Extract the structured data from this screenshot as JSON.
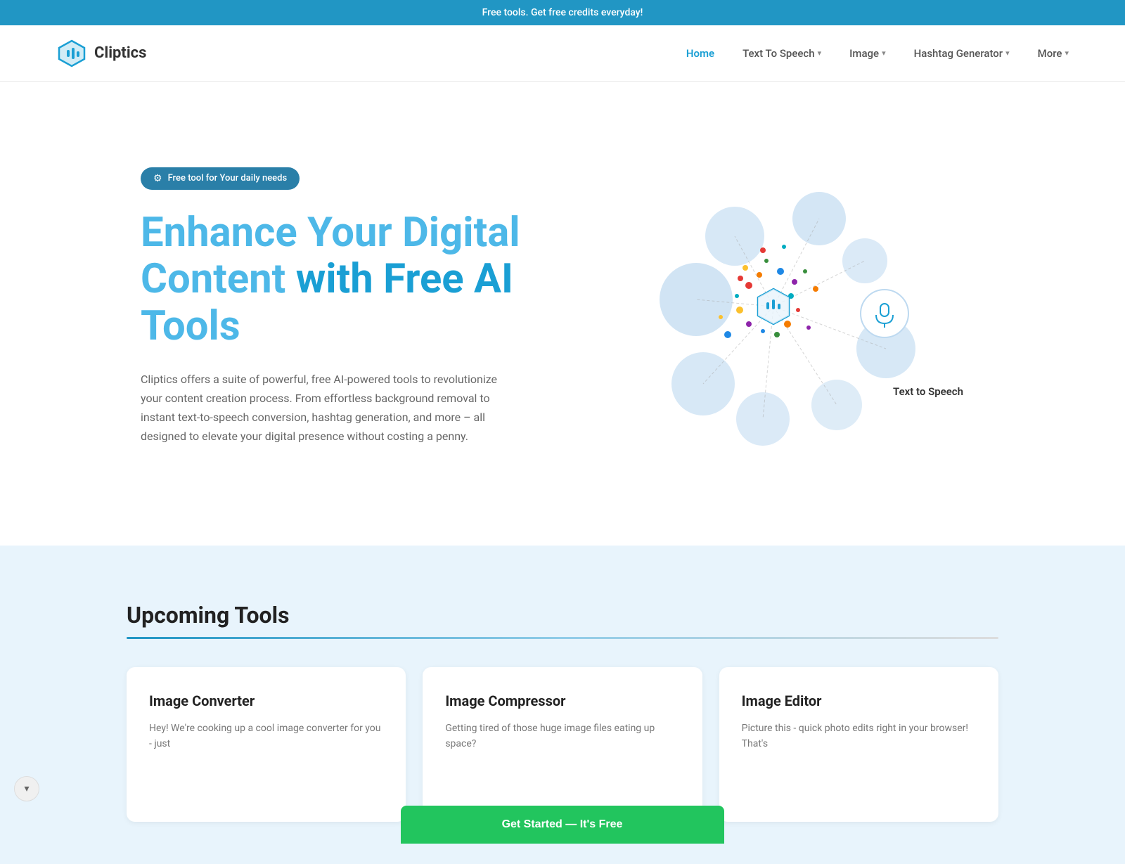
{
  "banner": {
    "text": "Free tools. Get free credits everyday!"
  },
  "nav": {
    "logo_text": "Cliptics",
    "links": [
      {
        "label": "Home",
        "active": true,
        "has_dropdown": false
      },
      {
        "label": "Text To Speech",
        "active": false,
        "has_dropdown": true
      },
      {
        "label": "Image",
        "active": false,
        "has_dropdown": true
      },
      {
        "label": "Hashtag Generator",
        "active": false,
        "has_dropdown": true
      },
      {
        "label": "More",
        "active": false,
        "has_dropdown": true
      }
    ]
  },
  "hero": {
    "badge_text": "Free tool for Your daily needs",
    "title_line1": "Enhance Your Digital",
    "title_line2": "Content with Free AI",
    "title_line3": "Tools",
    "description": "Cliptics offers a suite of powerful, free AI-powered tools to revolutionize your content creation process. From effortless background removal to instant text-to-speech conversion, hashtag generation, and more – all designed to elevate your digital presence without costing a penny.",
    "tts_label": "Text to Speech"
  },
  "upcoming": {
    "section_title": "Upcoming Tools",
    "tools": [
      {
        "title": "Image Converter",
        "description": "Hey! We're cooking up a cool image converter for you - just"
      },
      {
        "title": "Image Compressor",
        "description": "Getting tired of those huge image files eating up space?"
      },
      {
        "title": "Image Editor",
        "description": "Picture this - quick photo edits right in your browser! That's"
      }
    ]
  },
  "colors": {
    "primary": "#1a9fd4",
    "banner_bg": "#2196c4",
    "badge_bg": "#2a7fa8",
    "section_bg": "#e8f4fc",
    "green_btn": "#22c55e",
    "node_light": "#bdd9f0",
    "node_blue": "#60b8de"
  }
}
